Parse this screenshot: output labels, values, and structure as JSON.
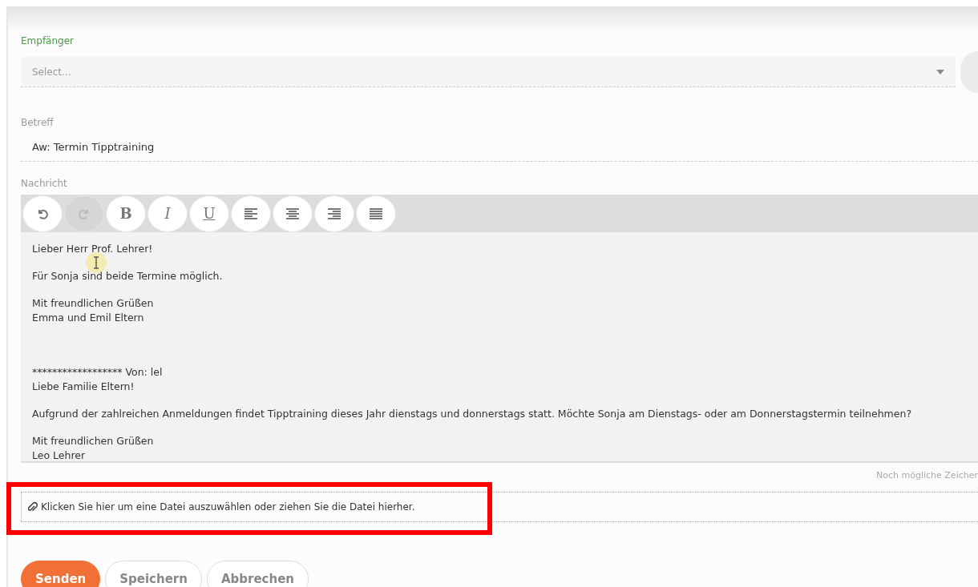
{
  "recipient": {
    "label": "Empfänger",
    "placeholder": "Select..."
  },
  "subject": {
    "label": "Betreff",
    "value": "Aw: Termin Tipptraining"
  },
  "message": {
    "label": "Nachricht",
    "toolbar": [
      {
        "kind": "undo",
        "disabled": false
      },
      {
        "kind": "redo",
        "disabled": true
      },
      {
        "kind": "bold",
        "text": "B",
        "disabled": false
      },
      {
        "kind": "italic",
        "text": "I",
        "disabled": false
      },
      {
        "kind": "underline",
        "text": "U",
        "disabled": false
      },
      {
        "kind": "align-left",
        "disabled": false
      },
      {
        "kind": "align-center",
        "disabled": false
      },
      {
        "kind": "align-right",
        "disabled": false
      },
      {
        "kind": "justify",
        "disabled": false
      }
    ],
    "paragraphs": [
      {
        "lines": [
          "Lieber Herr Prof. Lehrer!"
        ],
        "space_before": false
      },
      {
        "lines": [
          "Für Sonja sind beide Termine möglich."
        ],
        "space_before": false
      },
      {
        "lines": [
          "Mit freundlichen Grüßen",
          "Emma und Emil Eltern"
        ],
        "space_before": false
      },
      {
        "lines": [
          "****************** Von: lel",
          "Liebe Familie Eltern!"
        ],
        "space_before": true
      },
      {
        "lines": [
          "Aufgrund der zahlreichen Anmeldungen findet Tipptraining dieses Jahr dienstags und donnerstags statt. Möchte Sonja am Dienstags- oder am Donnerstagstermin teilnehmen?"
        ],
        "space_before": false
      },
      {
        "lines": [
          "Mit freundlichen Grüßen",
          "Leo Lehrer"
        ],
        "space_before": false
      }
    ],
    "counter": "Noch mögliche Zeicher"
  },
  "attachment": {
    "text": "Klicken Sie hier um eine Datei auszuwählen oder ziehen Sie die Datei hierher.",
    "highlighted": true
  },
  "buttons": [
    {
      "label": "Senden",
      "kind": "primary"
    },
    {
      "label": "Speichern",
      "kind": "secondary"
    },
    {
      "label": "Abbrechen",
      "kind": "secondary"
    }
  ]
}
